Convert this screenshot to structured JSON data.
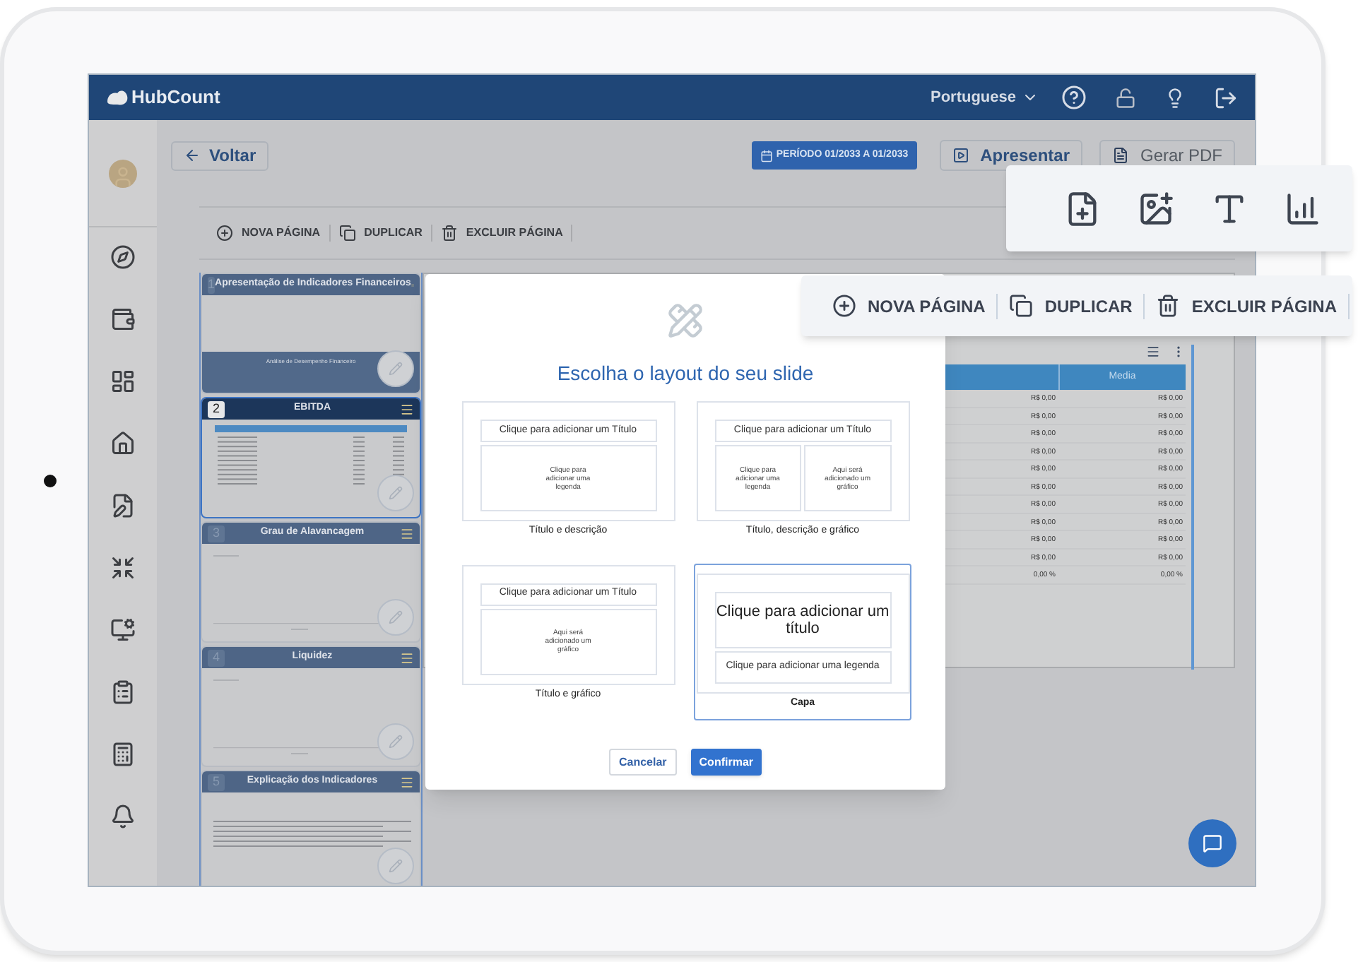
{
  "header": {
    "logo": "HubCount",
    "language": "Portuguese"
  },
  "top_bar": {
    "back_button": "Voltar",
    "period_button": "PERÍODO 01/2033 A 01/2033",
    "present_button": "Apresentar",
    "pdf_button": "Gerar PDF"
  },
  "toolbar": [
    {
      "kind": "add",
      "label": "NOVA PÁGINA"
    },
    {
      "kind": "duplicate",
      "label": "DUPLICAR"
    },
    {
      "kind": "delete",
      "label": "EXCLUIR PÁGINA"
    }
  ],
  "slides": [
    {
      "number": "1",
      "title": "Apresentação de Indicadores Financeiros",
      "subtitle": "Análise de Desempenho Financeiro",
      "kind": "cover",
      "selected": false
    },
    {
      "number": "2",
      "title": "EBITDA",
      "kind": "table",
      "selected": true
    },
    {
      "number": "3",
      "title": "Grau de Alavancagem",
      "kind": "chart",
      "selected": false
    },
    {
      "number": "4",
      "title": "Liquidez",
      "kind": "chart",
      "selected": false
    },
    {
      "number": "5",
      "title": "Explicação dos Indicadores",
      "kind": "text",
      "selected": false
    }
  ],
  "table": {
    "columns": [
      "Media"
    ],
    "rows": [
      [
        "R$ 0,00",
        "R$ 0,00"
      ],
      [
        "R$ 0,00",
        "R$ 0,00"
      ],
      [
        "R$ 0,00",
        "R$ 0,00"
      ],
      [
        "R$ 0,00",
        "R$ 0,00"
      ],
      [
        "R$ 0,00",
        "R$ 0,00"
      ],
      [
        "R$ 0,00",
        "R$ 0,00"
      ],
      [
        "R$ 0,00",
        "R$ 0,00"
      ],
      [
        "R$ 0,00",
        "R$ 0,00"
      ],
      [
        "R$ 0,00",
        "R$ 0,00"
      ],
      [
        "R$ 0,00",
        "R$ 0,00"
      ],
      [
        "0,00 %",
        "0,00 %"
      ]
    ]
  },
  "modal": {
    "title": "Escolha o layout do seu slide",
    "layouts": [
      {
        "kind": "standard",
        "title_placeholder": "Clique para adicionar um Título",
        "boxes": [
          "Clique para adicionar uma legenda"
        ],
        "caption": "Título e descrição",
        "selected": false
      },
      {
        "kind": "standard",
        "title_placeholder": "Clique para adicionar um Título",
        "boxes": [
          "Clique para adicionar uma legenda",
          "Aqui será adicionado um gráfico"
        ],
        "caption": "Título, descrição e gráfico",
        "selected": false
      },
      {
        "kind": "standard",
        "title_placeholder": "Clique para adicionar um Título",
        "boxes": [
          "Aqui será adicionado um gráfico"
        ],
        "caption": "Título e gráfico",
        "selected": false
      },
      {
        "kind": "cover",
        "title_placeholder": "Clique para adicionar um título",
        "boxes": [
          "Clique para adicionar uma legenda"
        ],
        "caption": "Capa",
        "selected": true
      }
    ],
    "cancel_button": "Cancelar",
    "confirm_button": "Confirmar"
  },
  "floating_toolbar": [
    {
      "kind": "add",
      "label": "NOVA PÁGINA"
    },
    {
      "kind": "duplicate",
      "label": "DUPLICAR"
    },
    {
      "kind": "delete",
      "label": "EXCLUIR PÁGINA"
    }
  ]
}
